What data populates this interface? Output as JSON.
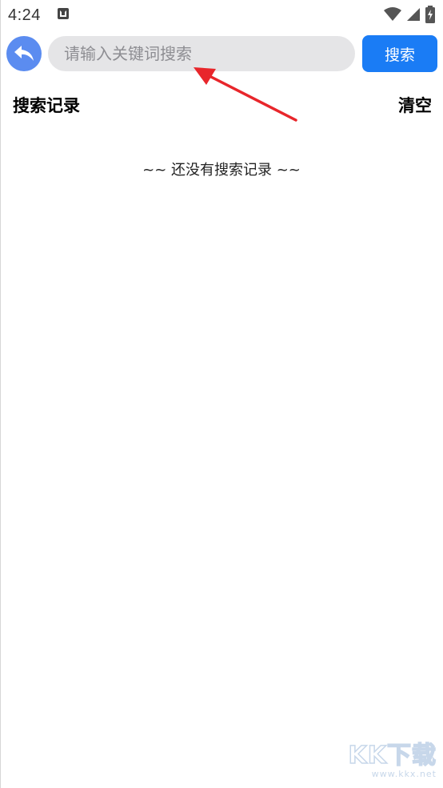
{
  "status_bar": {
    "time": "4:24",
    "icons": [
      "notification-a-icon",
      "wifi-icon",
      "signal-icon",
      "battery-charging-icon"
    ]
  },
  "search": {
    "placeholder": "请输入关键词搜索",
    "value": "",
    "button_label": "搜索"
  },
  "history": {
    "title": "搜索记录",
    "clear_label": "清空",
    "empty_message": "~~ 还没有搜索记录 ~~"
  },
  "watermark": {
    "logo": "KK下载",
    "url": "www.kkx.net"
  },
  "colors": {
    "accent": "#1a7cf5",
    "back_button": "#5b8cf0",
    "input_bg": "#e5e5e7",
    "annotation_arrow": "#e8262b"
  }
}
